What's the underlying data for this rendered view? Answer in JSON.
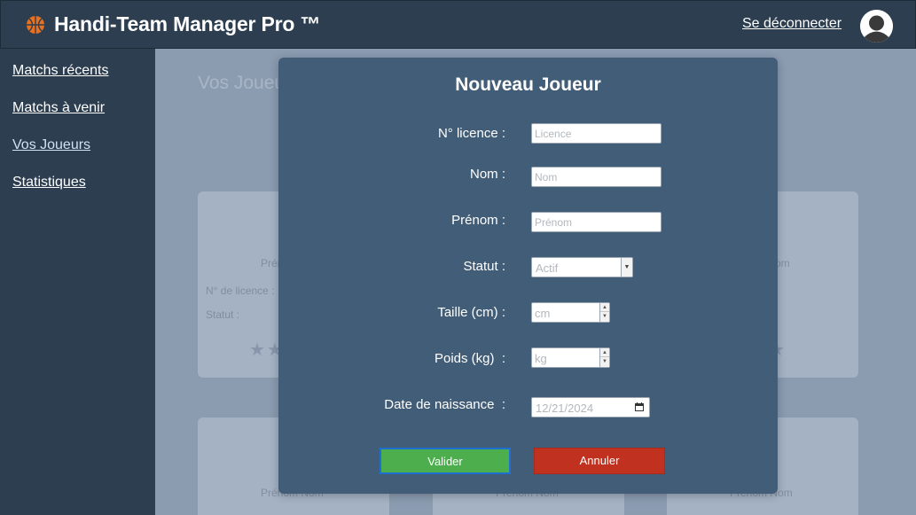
{
  "header": {
    "app_title": "Handi-Team Manager Pro ™",
    "logout_label": "Se déconnecter"
  },
  "sidebar": {
    "items": [
      {
        "label": "Matchs récents"
      },
      {
        "label": "Matchs à venir"
      },
      {
        "label": "Vos Joueurs"
      },
      {
        "label": "Statistiques"
      }
    ],
    "active_index": 2
  },
  "background_page": {
    "title": "Vos Joueu",
    "card_name": "Prénom Nom",
    "card_name_partial_left": "Prén",
    "card_name_partial_right": "om",
    "card_license_label": "N° de licence :",
    "card_status_label": "Statut :",
    "stars_left": "★★",
    "stars_right": "★"
  },
  "modal": {
    "title": "Nouveau Joueur",
    "fields": {
      "licence": {
        "label": "N° licence :",
        "placeholder": "Licence"
      },
      "nom": {
        "label": "Nom :",
        "placeholder": "Nom"
      },
      "prenom": {
        "label": "Prénom :",
        "placeholder": "Prénom"
      },
      "statut": {
        "label": "Statut :",
        "value": "Actif"
      },
      "taille": {
        "label": "Taille (cm) :",
        "placeholder": "cm"
      },
      "poids": {
        "label": "Poids (kg)  :",
        "placeholder": "kg"
      },
      "naissance": {
        "label": "Date de naissance  :",
        "value": "12/21/2024"
      }
    },
    "validate_label": "Valider",
    "cancel_label": "Annuler"
  },
  "colors": {
    "header_bg": "#2c3e50",
    "modal_bg": "#425d77",
    "validate": "#4cae4c",
    "cancel": "#c0321f",
    "basketball": "#e8711f"
  }
}
